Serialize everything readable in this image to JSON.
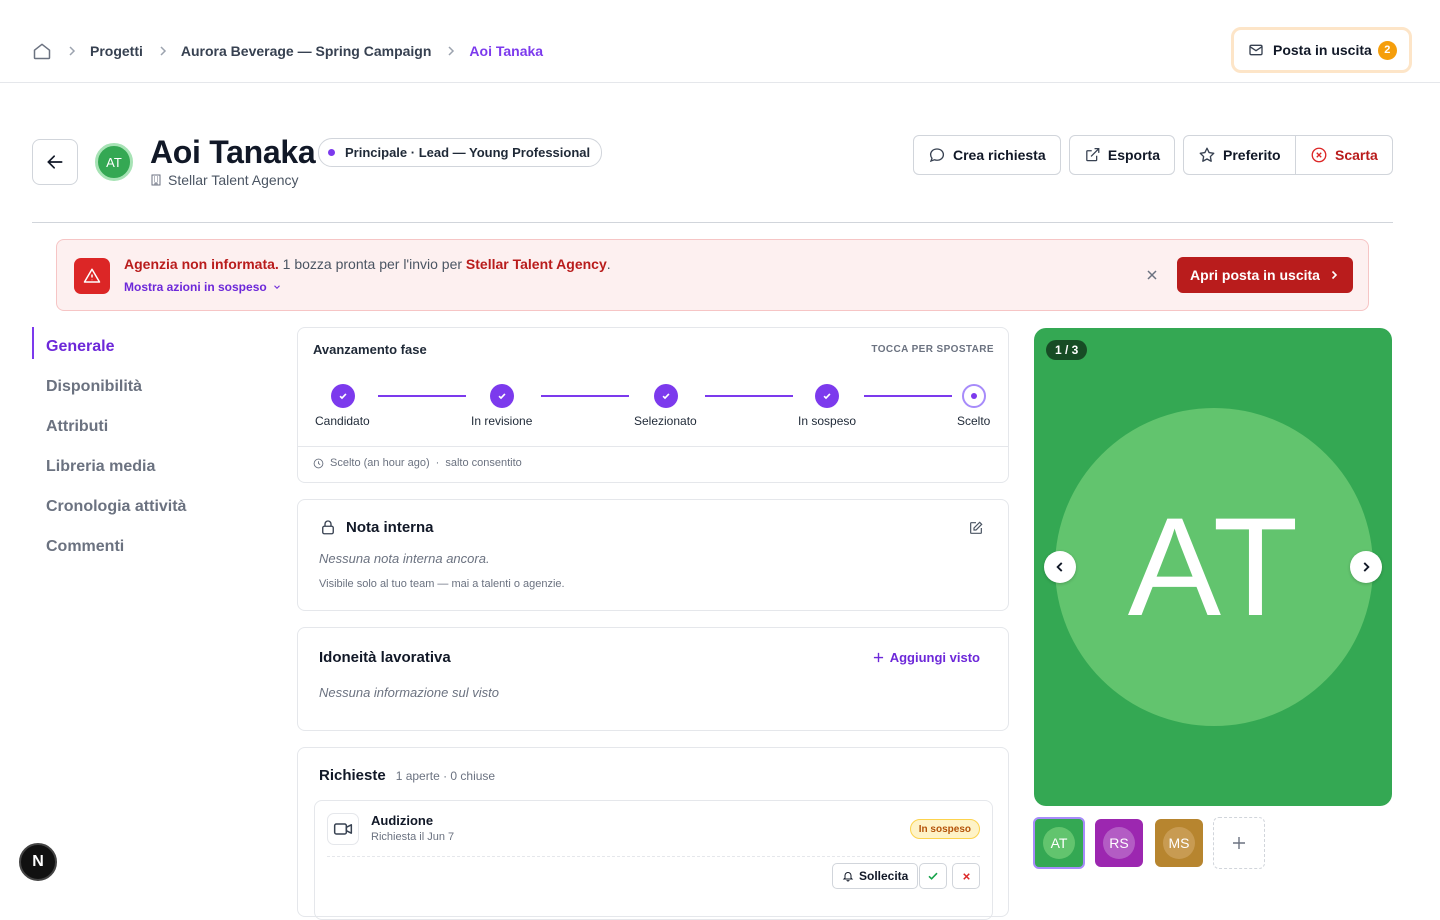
{
  "breadcrumb": {
    "items": [
      "Progetti",
      "Aurora Beverage — Spring Campaign"
    ],
    "current": "Aoi Tanaka"
  },
  "outbox": {
    "label": "Posta in uscita",
    "count": "2"
  },
  "talent": {
    "initials": "AT",
    "name": "Aoi Tanaka",
    "role": "Principale · Lead — Young Professional",
    "agency": "Stellar Talent Agency"
  },
  "actions": {
    "request": "Crea richiesta",
    "export": "Esporta",
    "favorite": "Preferito",
    "discard": "Scarta"
  },
  "alert": {
    "title": "Agenzia non informata.",
    "message": " 1 bozza pronta per l'invio per ",
    "agency": "Stellar Talent Agency",
    "period": ".",
    "toggle": "Mostra azioni in sospeso",
    "button": "Apri posta in uscita"
  },
  "sidenav": [
    "Generale",
    "Disponibilità",
    "Attributi",
    "Libreria media",
    "Cronologia attività",
    "Commenti"
  ],
  "stage": {
    "title": "Avanzamento fase",
    "hint": "TOCCA PER SPOSTARE",
    "steps": [
      "Candidato",
      "In revisione",
      "Selezionato",
      "In sospeso",
      "Scelto"
    ],
    "meta_time": "Scelto (an hour ago)",
    "meta_sep": "·",
    "meta_note": "salto consentito"
  },
  "note": {
    "title": "Nota interna",
    "empty": "Nessuna nota interna ancora.",
    "sub": "Visibile solo al tuo team — mai a talenti o agenzie."
  },
  "work": {
    "title": "Idoneità lavorativa",
    "add": "Aggiungi visto",
    "empty": "Nessuna informazione sul visto"
  },
  "requests": {
    "title": "Richieste",
    "count": "1 aperte · 0 chiuse",
    "item": {
      "title": "Audizione",
      "sub": "Richiesta il Jun 7",
      "status": "In sospeso",
      "nudge": "Sollecita"
    }
  },
  "media": {
    "counter": "1 / 3",
    "initials": "AT",
    "thumbs": [
      "AT",
      "RS",
      "MS"
    ],
    "colors": {
      "t1": "#34a853",
      "t2": "#9c27b0",
      "t3": "#b7852f"
    }
  },
  "dev_badge": "N",
  "colors": {
    "accent": "#7c3aed",
    "danger": "#b91c1c",
    "warning": "#f59e0b"
  }
}
